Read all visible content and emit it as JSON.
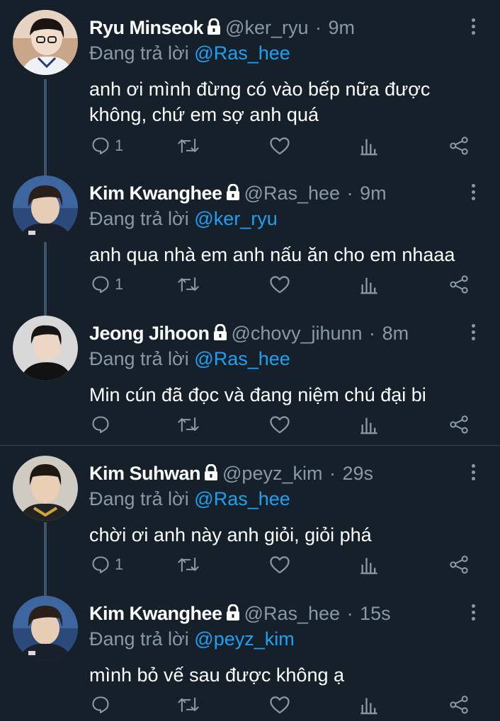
{
  "reply_prefix": "Đang trả lời",
  "colors": {
    "background": "#15202b",
    "text": "#ffffff",
    "secondary": "#8899a6",
    "accent": "#1da1f2",
    "thread_line": "#3d5466"
  },
  "tweets": [
    {
      "name": "Ryu Minseok",
      "handle": "@ker_ryu",
      "sep": "·",
      "time": "9m",
      "reply_to": "@Ras_hee",
      "text": "anh ơi mình đừng có vào bếp nữa được không, chứ em sợ anh quá",
      "reply_count": "1",
      "avatar_icon": "avatar-photo"
    },
    {
      "name": "Kim Kwanghee",
      "handle": "@Ras_hee",
      "sep": "·",
      "time": "9m",
      "reply_to": "@ker_ryu",
      "text": "anh qua nhà em anh nấu ăn cho em nhaaa",
      "reply_count": "1",
      "avatar_icon": "avatar-photo"
    },
    {
      "name": "Jeong Jihoon",
      "handle": "@chovy_jihunn",
      "sep": "·",
      "time": "8m",
      "reply_to": "@Ras_hee",
      "text": "Min cún đã đọc và đang niệm chú đại bi",
      "reply_count": "",
      "avatar_icon": "avatar-photo"
    },
    {
      "name": "Kim Suhwan",
      "handle": "@peyz_kim",
      "sep": "·",
      "time": "29s",
      "reply_to": "@Ras_hee",
      "text": "chời ơi anh này anh giỏi, giỏi phá",
      "reply_count": "1",
      "avatar_icon": "avatar-photo"
    },
    {
      "name": "Kim Kwanghee",
      "handle": "@Ras_hee",
      "sep": "·",
      "time": "15s",
      "reply_to": "@peyz_kim",
      "text": "mình bỏ vế sau được không ạ",
      "reply_count": "",
      "avatar_icon": "avatar-photo"
    }
  ],
  "action_icons": [
    "reply-icon",
    "retweet-icon",
    "like-icon",
    "analytics-icon",
    "share-icon"
  ]
}
